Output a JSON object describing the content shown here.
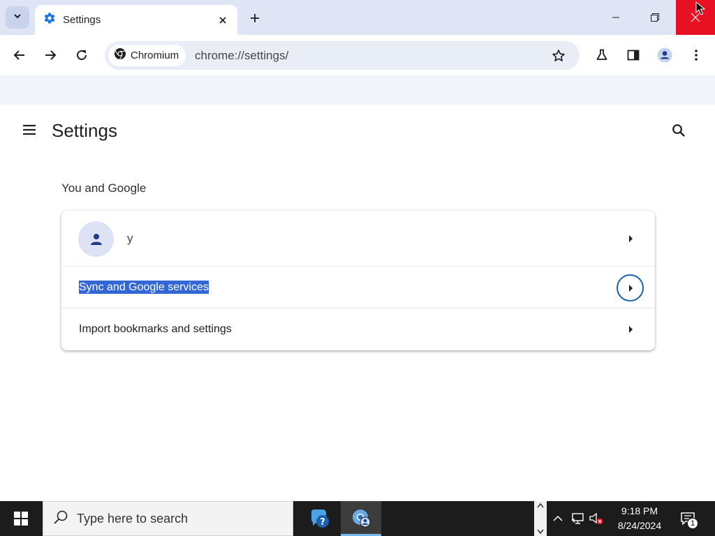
{
  "browser": {
    "tab_title": "Settings",
    "chip_label": "Chromium",
    "url": "chrome://settings/"
  },
  "settings": {
    "page_title": "Settings",
    "section_title": "You and Google",
    "profile_name": "y",
    "rows": [
      {
        "label": "Sync and Google services",
        "selected": true
      },
      {
        "label": "Import bookmarks and settings",
        "selected": false
      }
    ]
  },
  "taskbar": {
    "search_placeholder": "Type here to search",
    "time": "9:18 PM",
    "date": "8/24/2024",
    "notification_count": "1"
  },
  "colors": {
    "accent": "#1a5fb4",
    "selection": "#3367d6",
    "close_button": "#e81123"
  }
}
